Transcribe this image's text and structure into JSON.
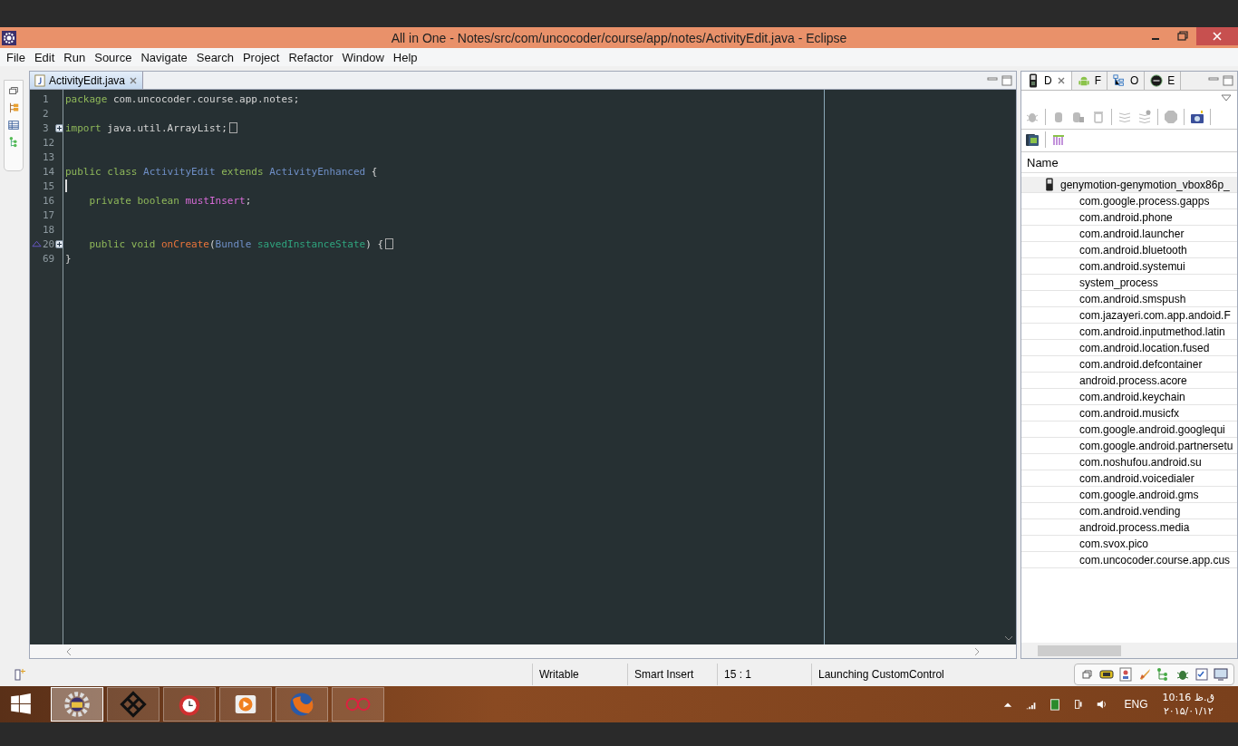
{
  "window": {
    "title": "All in One - Notes/src/com/uncocoder/course/app/notes/ActivityEdit.java - Eclipse"
  },
  "menu": [
    "File",
    "Edit",
    "Run",
    "Source",
    "Navigate",
    "Search",
    "Project",
    "Refactor",
    "Window",
    "Help"
  ],
  "editor": {
    "tabs": [
      {
        "label": "ActivityEdit.java",
        "selected": true
      }
    ],
    "lines": [
      {
        "number": "1",
        "tokens": [
          {
            "kind": "keyword",
            "text": "package "
          },
          {
            "kind": "plain",
            "text": "com.uncocoder.course.app.notes;"
          }
        ]
      },
      {
        "number": "2"
      },
      {
        "number": "3",
        "fold": true,
        "collapsed": true,
        "tokens": [
          {
            "kind": "keyword",
            "text": "import "
          },
          {
            "kind": "plain",
            "text": "java.util.ArrayList;"
          }
        ]
      },
      {
        "number": "12"
      },
      {
        "number": "13"
      },
      {
        "number": "14",
        "tokens": [
          {
            "kind": "keyword",
            "text": "public class "
          },
          {
            "kind": "type",
            "text": "ActivityEdit "
          },
          {
            "kind": "keyword",
            "text": "extends "
          },
          {
            "kind": "type",
            "text": "ActivityEnhanced "
          },
          {
            "kind": "plain",
            "text": "{"
          }
        ]
      },
      {
        "number": "15",
        "cursor": true
      },
      {
        "number": "16",
        "tokens": [
          {
            "kind": "keyword",
            "text": "    private boolean "
          },
          {
            "kind": "field",
            "text": "mustInsert"
          },
          {
            "kind": "plain",
            "text": ";"
          }
        ]
      },
      {
        "number": "17"
      },
      {
        "number": "18"
      },
      {
        "number": "20",
        "fold": true,
        "override": true,
        "collapsed": true,
        "tokens": [
          {
            "kind": "keyword",
            "text": "    public void "
          },
          {
            "kind": "method",
            "text": "onCreate"
          },
          {
            "kind": "plain",
            "text": "("
          },
          {
            "kind": "type",
            "text": "Bundle "
          },
          {
            "kind": "param",
            "text": "savedInstanceState"
          },
          {
            "kind": "plain",
            "text": ") {"
          }
        ]
      },
      {
        "number": "69",
        "tokens": [
          {
            "kind": "plain",
            "text": "}"
          }
        ]
      }
    ]
  },
  "devices_view": {
    "tabs": [
      {
        "label": "D",
        "selected": true
      },
      {
        "label": "F",
        "selected": false
      },
      {
        "label": "O",
        "selected": false
      },
      {
        "label": "E",
        "selected": false
      }
    ],
    "column": "Name",
    "tree": [
      {
        "label": "genymotion-genymotion_vbox86p_",
        "selected": true,
        "children": [
          {
            "label": "com.google.process.gapps"
          },
          {
            "label": "com.android.phone"
          },
          {
            "label": "com.android.launcher"
          },
          {
            "label": "com.android.bluetooth"
          },
          {
            "label": "com.android.systemui"
          },
          {
            "label": "system_process"
          },
          {
            "label": "com.android.smspush"
          },
          {
            "label": "com.jazayeri.com.app.andoid.F"
          },
          {
            "label": "com.android.inputmethod.latin"
          },
          {
            "label": "com.android.location.fused"
          },
          {
            "label": "com.android.defcontainer"
          },
          {
            "label": "android.process.acore"
          },
          {
            "label": "com.android.keychain"
          },
          {
            "label": "com.android.musicfx"
          },
          {
            "label": "com.google.android.googlequi"
          },
          {
            "label": "com.google.android.partnersetu"
          },
          {
            "label": "com.noshufou.android.su"
          },
          {
            "label": "com.android.voicedialer"
          },
          {
            "label": "com.google.android.gms"
          },
          {
            "label": "com.android.vending"
          },
          {
            "label": "android.process.media"
          },
          {
            "label": "com.svox.pico"
          },
          {
            "label": "com.uncocoder.course.app.cus"
          }
        ]
      }
    ]
  },
  "status_bar": {
    "mode": "Writable",
    "insert": "Smart Insert",
    "position": "15 : 1",
    "task": "Launching CustomControl"
  },
  "taskbar": {
    "apps": [
      {
        "selected": true
      },
      {
        "selected": false
      },
      {
        "selected": false
      },
      {
        "selected": false
      },
      {
        "selected": false
      },
      {
        "selected": false
      }
    ],
    "language": "ENG",
    "time": "10:16 ق.ظ",
    "date": "۲۰۱۵/۰۱/۱۲"
  }
}
